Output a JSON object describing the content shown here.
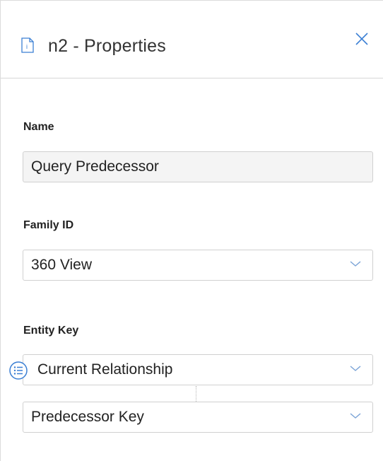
{
  "panel": {
    "title": "n2 - Properties",
    "icons": {
      "title_icon": "document-info-icon",
      "close": "close-icon"
    }
  },
  "fields": {
    "name": {
      "label": "Name",
      "value": "Query Predecessor"
    },
    "family_id": {
      "label": "Family ID",
      "value": "360 View",
      "icon": "chevron-down-icon"
    },
    "entity_key": {
      "label": "Entity Key",
      "list_icon": "list-icon",
      "relationship": {
        "value": "Current Relationship",
        "icon": "chevron-down-icon"
      },
      "key": {
        "value": "Predecessor Key",
        "icon": "chevron-down-icon"
      }
    }
  },
  "colors": {
    "accent": "#3b7fd4",
    "border": "#d0d0d0",
    "input_bg": "#f4f4f4"
  }
}
